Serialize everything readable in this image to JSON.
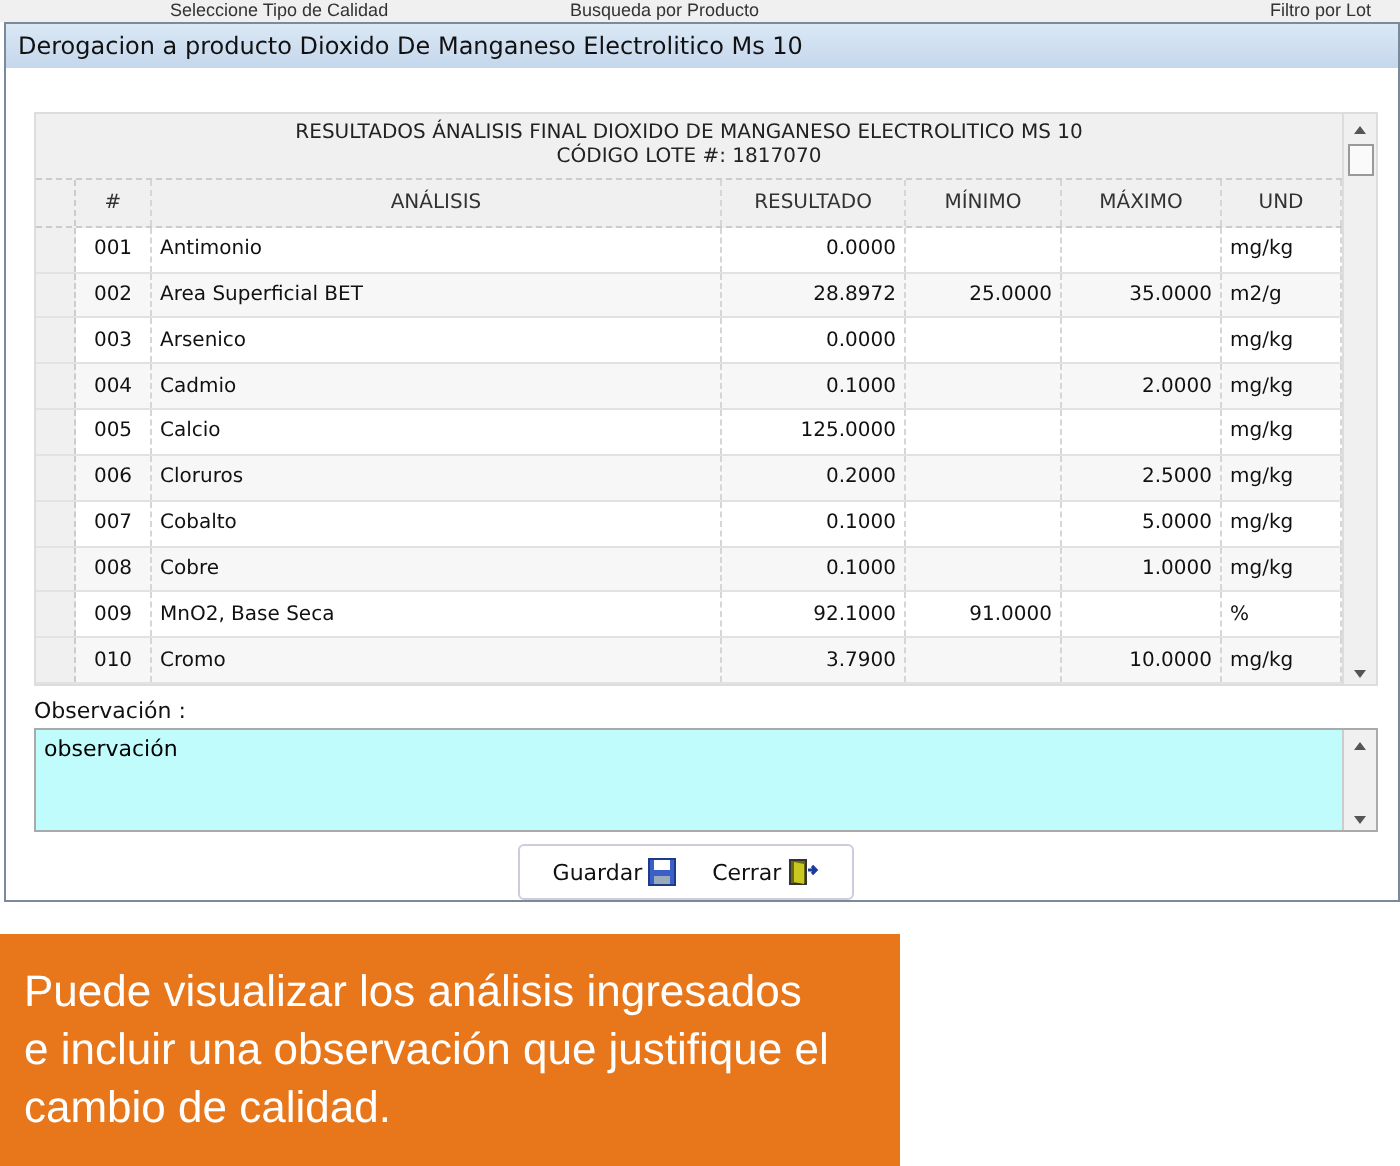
{
  "background_labels": [
    "Seleccione Tipo de Calidad",
    "Busqueda por Producto",
    "Filtro por Lot"
  ],
  "window": {
    "title": "Derogacion a producto Dioxido De Manganeso Electrolitico Ms 10"
  },
  "table": {
    "title": "RESULTADOS ÁNALISIS FINAL DIOXIDO DE MANGANESO ELECTROLITICO MS 10",
    "subtitle": "CÓDIGO LOTE #: 1817070",
    "columns": [
      "#",
      "ANÁLISIS",
      "RESULTADO",
      "MÍNIMO",
      "MÁXIMO",
      "UND"
    ],
    "rows": [
      [
        "001",
        "Antimonio",
        "0.0000",
        "",
        "",
        "mg/kg"
      ],
      [
        "002",
        "Area Superficial BET",
        "28.8972",
        "25.0000",
        "35.0000",
        "m2/g"
      ],
      [
        "003",
        "Arsenico",
        "0.0000",
        "",
        "",
        "mg/kg"
      ],
      [
        "004",
        "Cadmio",
        "0.1000",
        "",
        "2.0000",
        "mg/kg"
      ],
      [
        "005",
        "Calcio",
        "125.0000",
        "",
        "",
        "mg/kg"
      ],
      [
        "006",
        "Cloruros",
        "0.2000",
        "",
        "2.5000",
        "mg/kg"
      ],
      [
        "007",
        "Cobalto",
        "0.1000",
        "",
        "5.0000",
        "mg/kg"
      ],
      [
        "008",
        "Cobre",
        "0.1000",
        "",
        "1.0000",
        "mg/kg"
      ],
      [
        "009",
        "MnO2, Base Seca",
        "92.1000",
        "91.0000",
        "",
        "%"
      ],
      [
        "010",
        "Cromo",
        "3.7900",
        "",
        "10.0000",
        "mg/kg"
      ]
    ]
  },
  "observation": {
    "label": "Observación  :",
    "value": "observación"
  },
  "buttons": [
    "Guardar",
    "Cerrar"
  ],
  "callout": "Puede visualizar los análisis ingresados e incluir una observación que justifique el cambio de calidad."
}
